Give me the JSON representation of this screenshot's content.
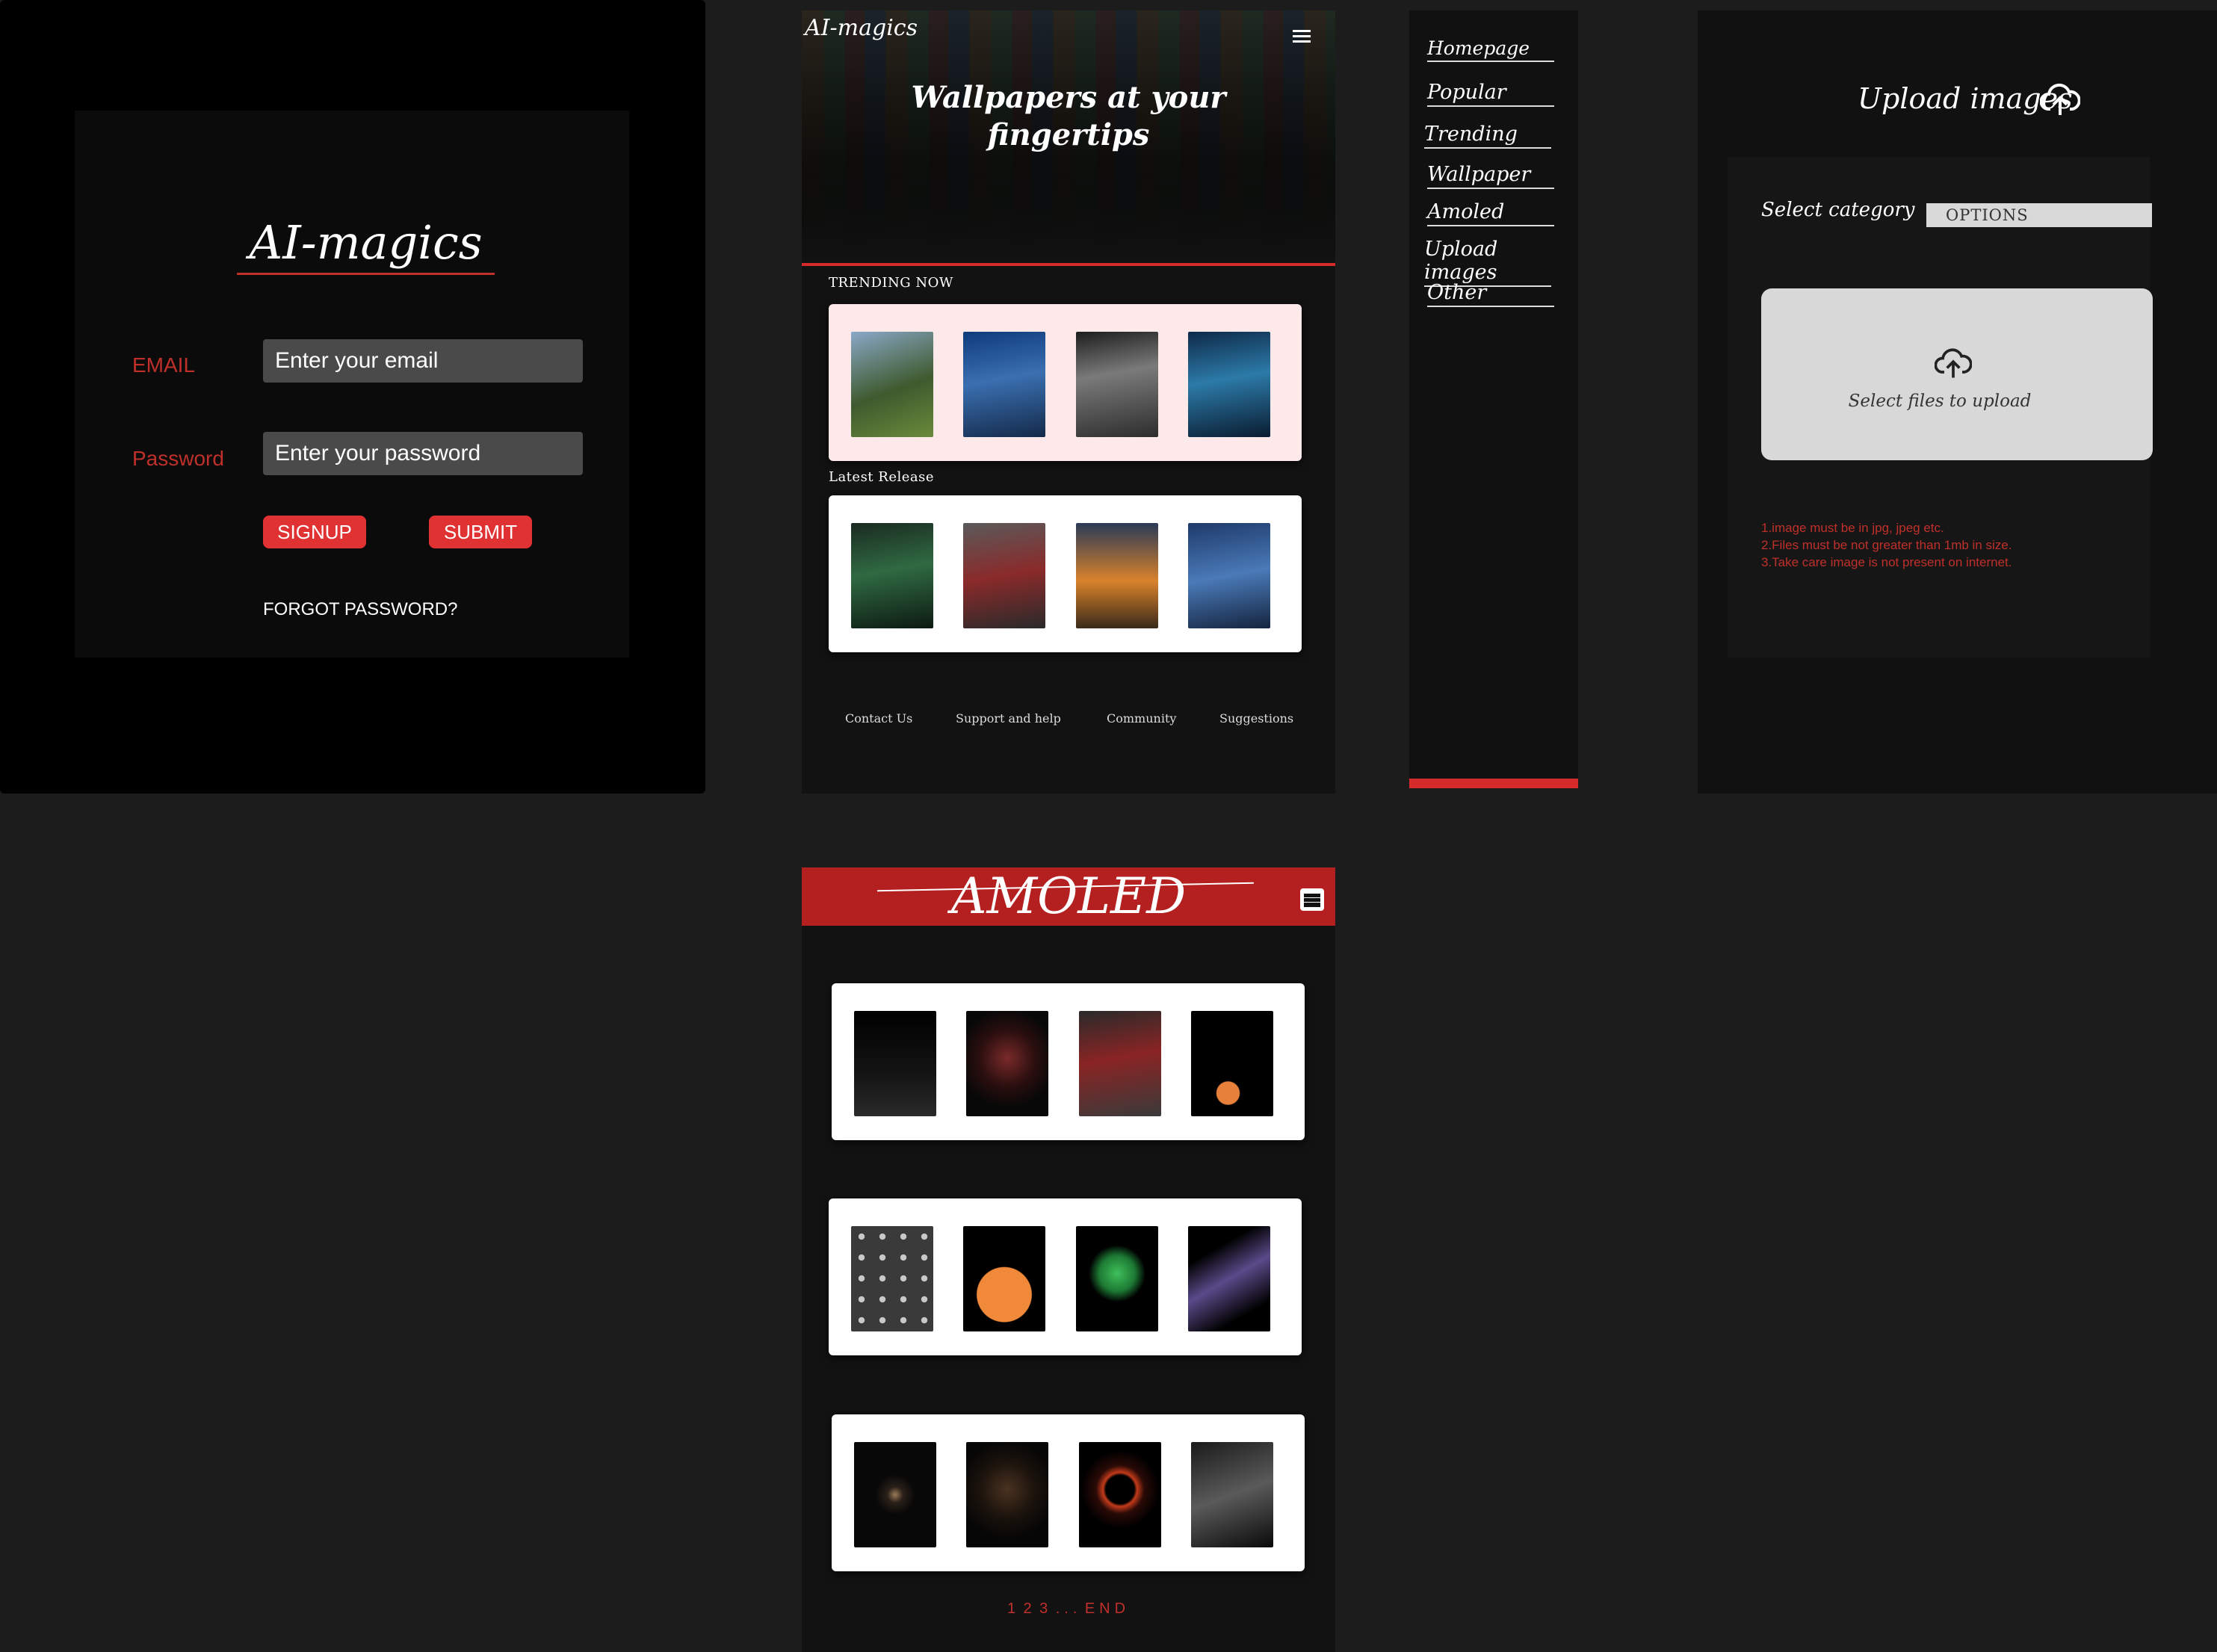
{
  "login": {
    "title": "AI-magics",
    "email_label": "EMAIL",
    "email_placeholder": "Enter your email",
    "password_label": "Password",
    "password_placeholder": "Enter your password",
    "signup_label": "SIGNUP",
    "submit_label": "SUBMIT",
    "forgot_label": "FORGOT PASSWORD?"
  },
  "home": {
    "logo": "AI-magics",
    "hero_title_line1": "Wallpapers at your",
    "hero_title_line2": "fingertips",
    "trending_title": "TRENDING NOW",
    "latest_title": "Latest Release",
    "trending_images": [
      "tank-wallpaper",
      "warrior-blue-wallpaper",
      "witcher-ciri-wallpaper",
      "cyber-ninja-wallpaper"
    ],
    "latest_images": [
      "hooded-green-eyes-wallpaper",
      "pirate-hunter-wallpaper",
      "sunset-soldier-wallpaper",
      "sword-ninja-wallpaper"
    ],
    "footer": [
      "Contact Us",
      "Support and help",
      "Community",
      "Suggestions"
    ]
  },
  "sidebar": {
    "items": [
      {
        "label": "Homepage"
      },
      {
        "label": "Popular"
      },
      {
        "label": "Trending"
      },
      {
        "label": "Wallpaper"
      },
      {
        "label": "Amoled"
      },
      {
        "label": "Upload images"
      },
      {
        "label": "Other"
      }
    ]
  },
  "upload": {
    "title": "Upload images",
    "category_label": "Select category",
    "category_value": "OPTIONS",
    "dropzone_label": "Select files to upload",
    "rules": [
      "1.image must be in jpg, jpeg etc.",
      "2.Files must be not greater than 1mb in size.",
      "3.Take care image is not present on internet."
    ]
  },
  "amoled": {
    "title": "AMOLED",
    "rows": [
      [
        "road-night",
        "red-ring-figure",
        "robot-motorbike",
        "orange-sun-mountains"
      ],
      [
        "grey-circles",
        "orange-sunset-silhouette",
        "green-skull",
        "purple-smoke"
      ],
      [
        "xwing-fighter",
        "dark-dog",
        "red-eclipse",
        "hooded-assassin"
      ]
    ],
    "pager": [
      "1",
      "2",
      "3",
      "...",
      "END"
    ]
  },
  "colors": {
    "accent": "#d62b2b",
    "background": "#1c1c1c",
    "panel": "#111111"
  }
}
